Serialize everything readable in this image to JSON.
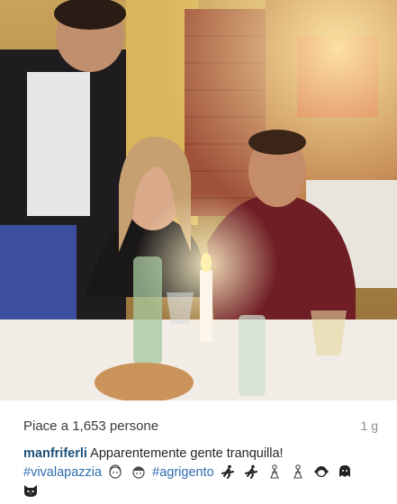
{
  "post": {
    "likes_text": "Piace a 1,653 persone",
    "time_ago": "1 g",
    "username": "manfriferli",
    "caption_text": "Apparentemente gente tranquilla!",
    "hashtags": [
      "#vivalapazzia",
      "#agrigento"
    ],
    "emoji_icons_line1": [
      "woman-face-icon",
      "man-face-icon"
    ],
    "emoji_icons_line2": [
      "runner-icon",
      "runner-icon",
      "dancer-icon",
      "dancer-icon",
      "monkey-face-icon",
      "ghost-face-icon"
    ],
    "emoji_icons_line3": [
      "cat-face-icon"
    ]
  },
  "colors": {
    "username": "#1d4f7a",
    "hashtag": "#2f6db0",
    "muted_text": "#8e8e8e"
  }
}
